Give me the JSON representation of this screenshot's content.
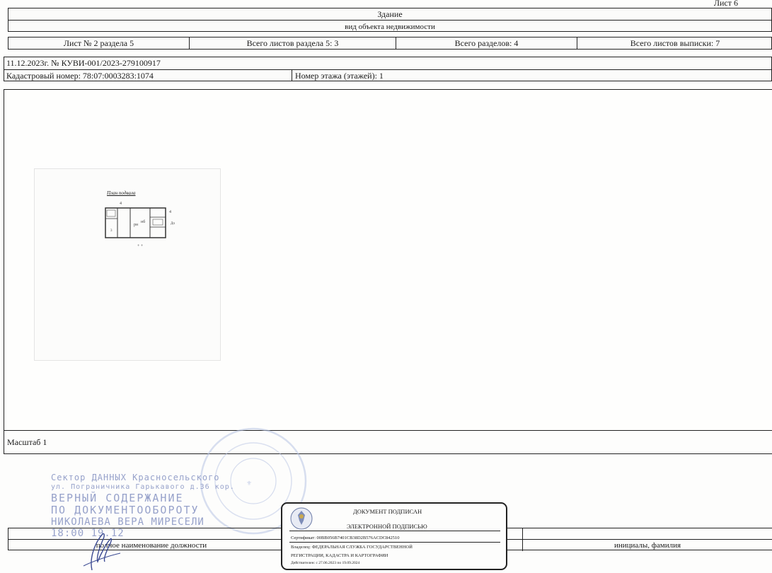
{
  "sheet_label": "Лист 6",
  "header": {
    "object_type": "Здание",
    "object_caption": "вид объекта недвижимости"
  },
  "sheet_info": {
    "sheet_no": "Лист № 2 раздела 5",
    "sheets_in_section": "Всего листов раздела 5: 3",
    "total_sections": "Всего разделов: 4",
    "total_sheets": "Всего листов выписки: 7"
  },
  "record": {
    "date_number": "11.12.2023г. № КУВИ-001/2023-279100917",
    "cadastral_number": "Кадастровый номер: 78:07:0003283:1074",
    "floor_number": "Номер этажа (этажей): 1"
  },
  "plan": {
    "sketch_title": "План подвала"
  },
  "scale": "Масштаб 1",
  "stamp": {
    "lines": [
      "Сектор ДАННЫХ Красносельского",
      "ул. Пограничника Гарькавого д.36 кор.",
      "ВЕРНЫЙ СОДЕРЖАНИЕ",
      "ПО ДОКУМЕНТООБОРОТУ",
      "НИКОЛАЕВА ВЕРА МИРЕСЕЛИ",
      "18:00    19.12"
    ]
  },
  "signature_block": {
    "title_line1": "ДОКУМЕНТ ПОДПИСАН",
    "title_line2": "ЭЛЕКТРОННОЙ ПОДПИСЬЮ",
    "certificate": "Сертификат: 00BB056B7401CB38D2B576ACDC842510",
    "owner_line1": "Владелец: ФЕДЕРАЛЬНАЯ СЛУЖБА ГОСУДАРСТВЕННОЙ",
    "owner_line2": "РЕГИСТРАЦИИ, КАДАСТРА И КАРТОГРАФИИ",
    "validity": "Действителен: с 27.06.2023 по 19.09.2024"
  },
  "footer": {
    "position_caption": "полное наименование должности",
    "initials_caption": "инициалы, фамилия"
  },
  "colors": {
    "stamp_blue": "#8592c2",
    "ink": "#1a1a1a"
  }
}
